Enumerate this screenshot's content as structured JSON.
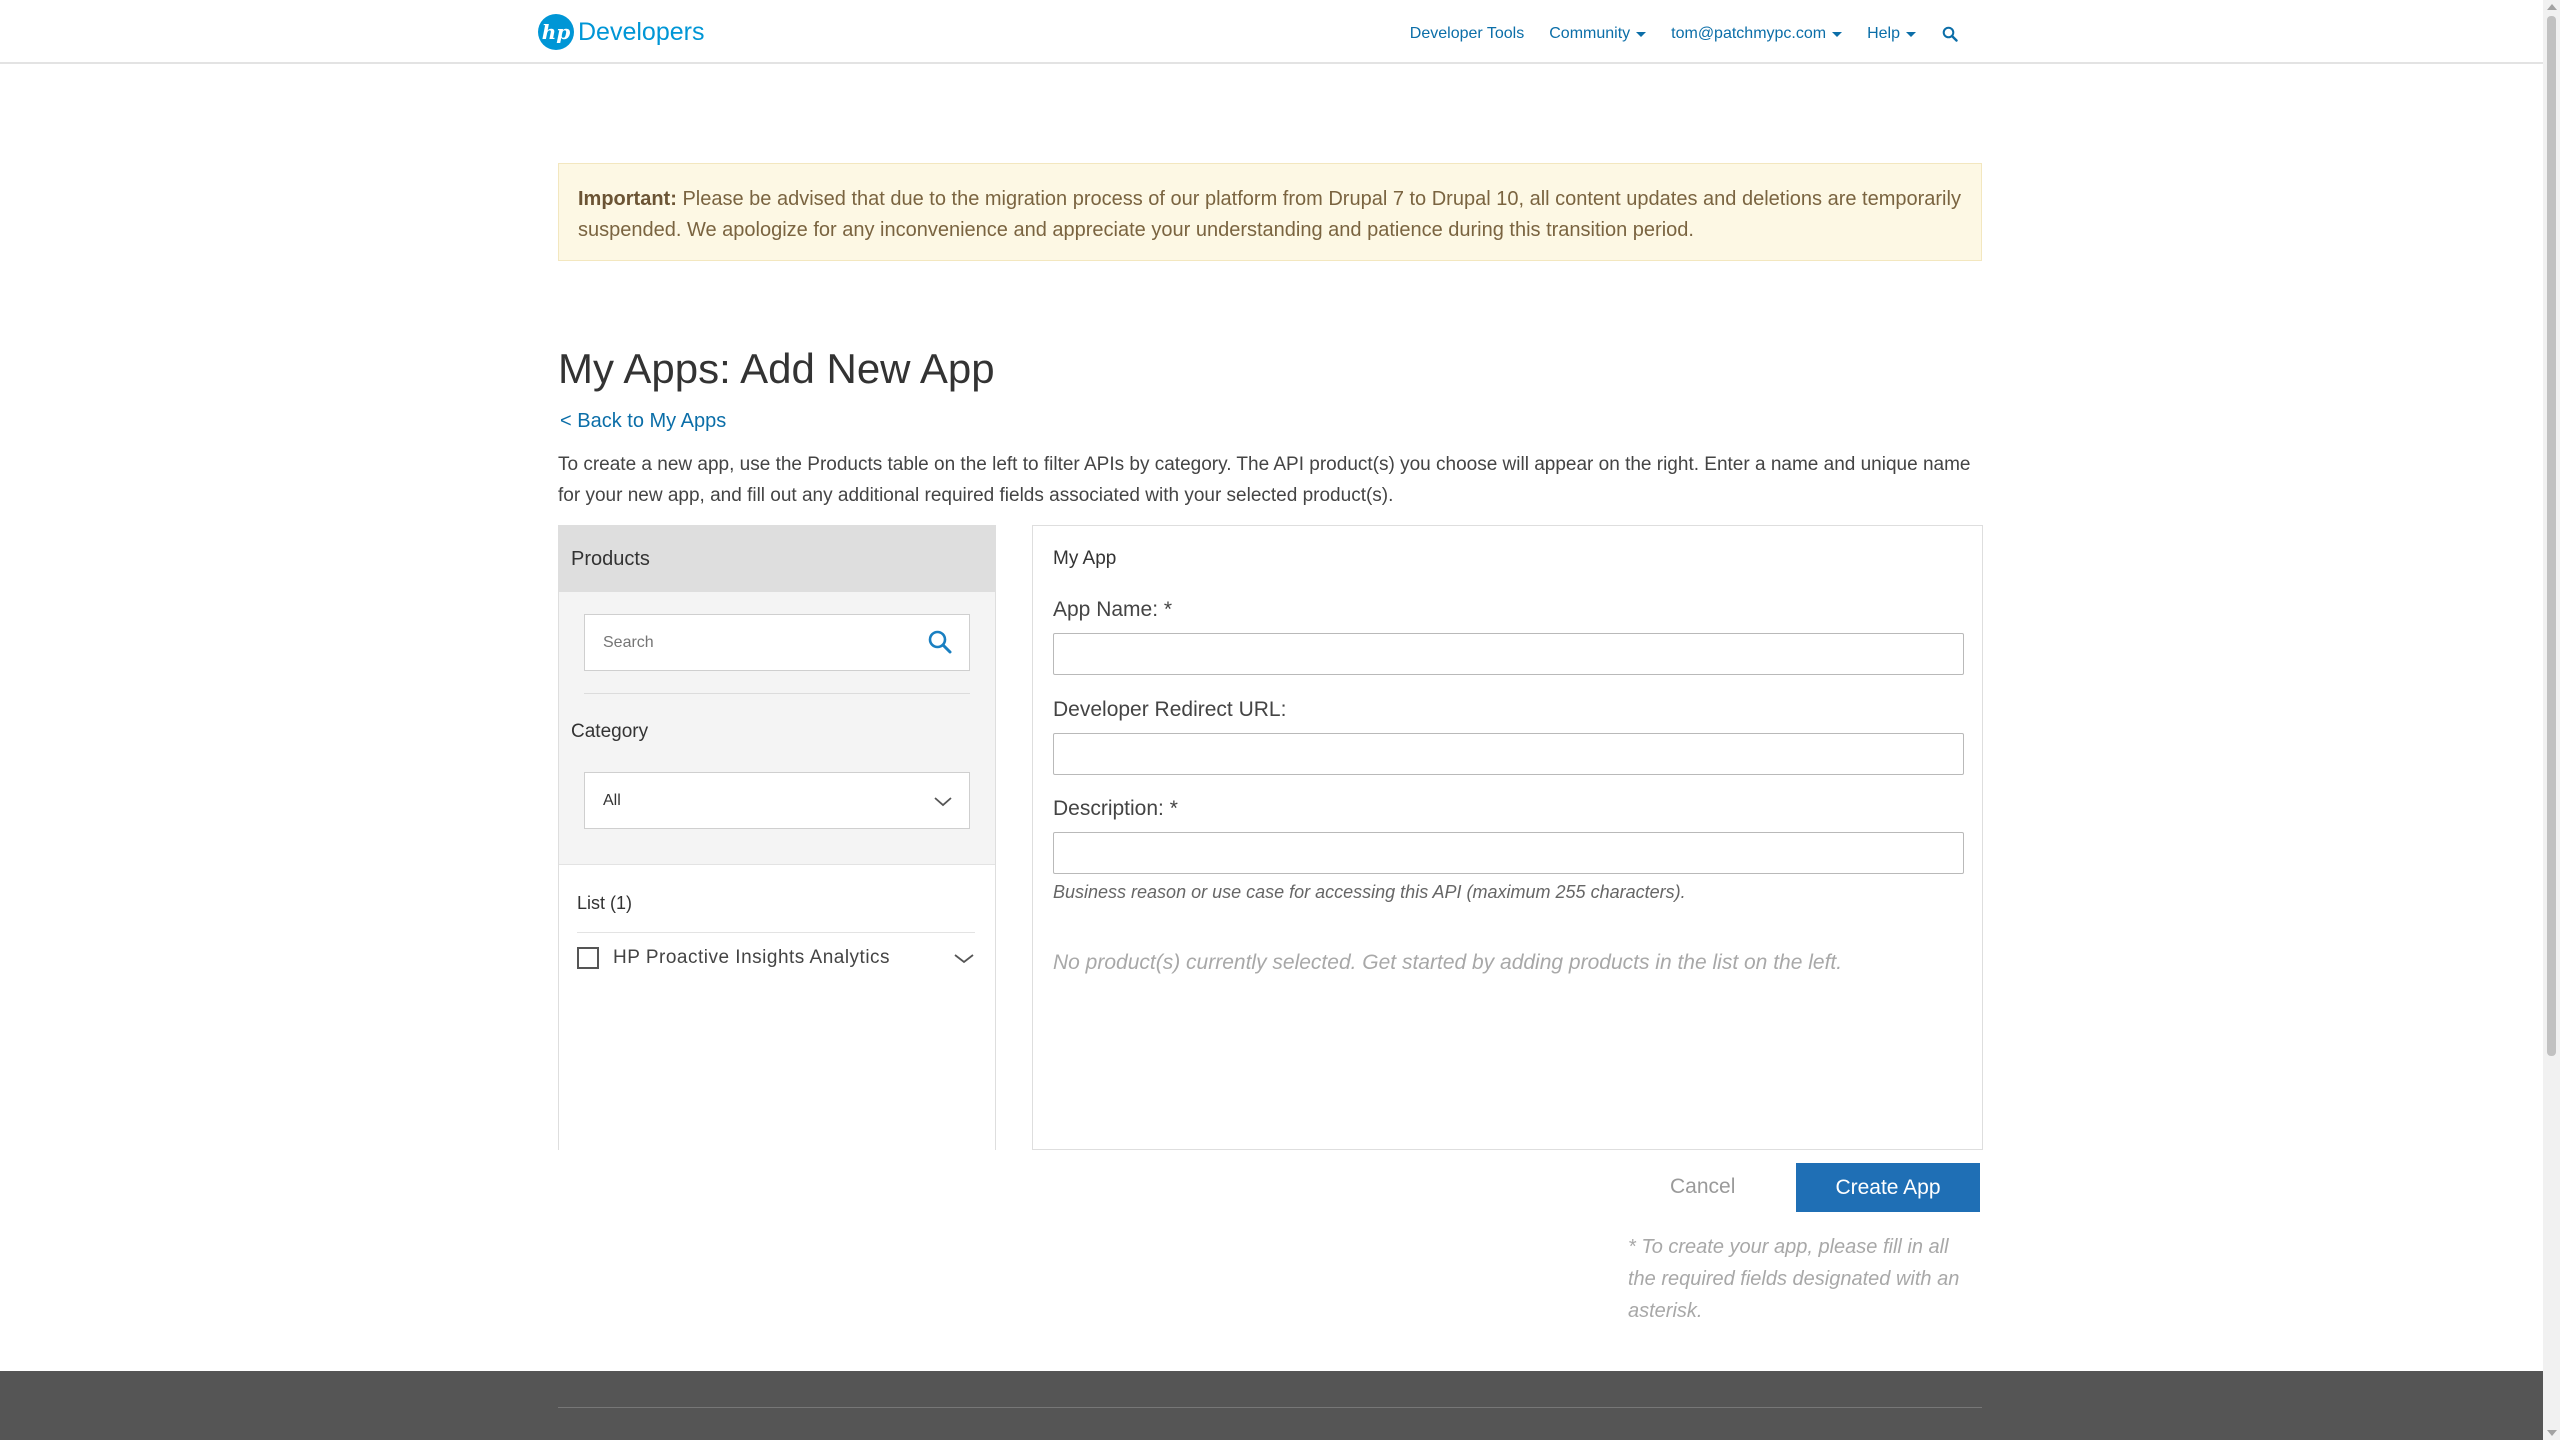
{
  "header": {
    "logo_mark": "hp",
    "logo_text": "Developers",
    "nav": [
      {
        "label": "Developer Tools",
        "has_caret": false
      },
      {
        "label": "Community",
        "has_caret": true
      },
      {
        "label": "tom@patchmypc.com",
        "has_caret": true
      },
      {
        "label": "Help",
        "has_caret": true
      }
    ],
    "search_icon": "search-icon"
  },
  "notice": {
    "strong": "Important:",
    "text": " Please be advised that due to the migration process of our platform from Drupal 7 to Drupal 10, all content updates and deletions are temporarily suspended. We apologize for any inconvenience and appreciate your understanding and patience during this transition period."
  },
  "page": {
    "title": "My Apps: Add New App",
    "back_link": "< Back to My Apps",
    "intro": "To create a new app, use the Products table on the left to filter APIs by category. The API product(s) you choose will appear on the right. Enter a name and unique name for your new app, and fill out any additional required fields associated with your selected product(s)."
  },
  "products": {
    "heading": "Products",
    "search_placeholder": "Search",
    "category_label": "Category",
    "category_value": "All",
    "list_title": "List (1)",
    "items": [
      {
        "label": "HP Proactive Insights Analytics",
        "checked": false
      }
    ]
  },
  "myapp": {
    "heading": "My App",
    "app_name_label": "App Name: *",
    "redirect_label": "Developer Redirect URL:",
    "description_label": "Description: *",
    "description_help": "Business reason or use case for accessing this API (maximum 255 characters).",
    "empty_text": "No product(s) currently selected. Get started by adding products in the list on the left."
  },
  "actions": {
    "cancel": "Cancel",
    "create": "Create App",
    "required_note": "* To create your app, please fill in all the required fields designated with an asterisk."
  },
  "colors": {
    "accent": "#0096d6",
    "link": "#0b6ea8",
    "primary_button": "#1f6fb5",
    "notice_bg": "#fdf8e4",
    "footer_bg": "#555555"
  }
}
